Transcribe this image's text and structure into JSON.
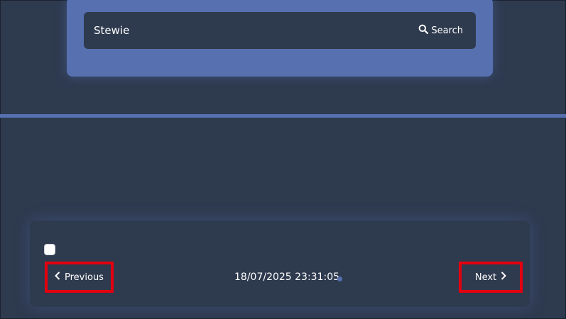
{
  "search": {
    "value": "Stewie",
    "button_label": "Search",
    "icon": "search-icon"
  },
  "pagination": {
    "previous_label": "Previous",
    "next_label": "Next",
    "timestamp": "18/07/2025 23:31:05"
  },
  "colors": {
    "background": "#2e3a4e",
    "accent": "#5670b0",
    "highlight": "#e3000f"
  }
}
